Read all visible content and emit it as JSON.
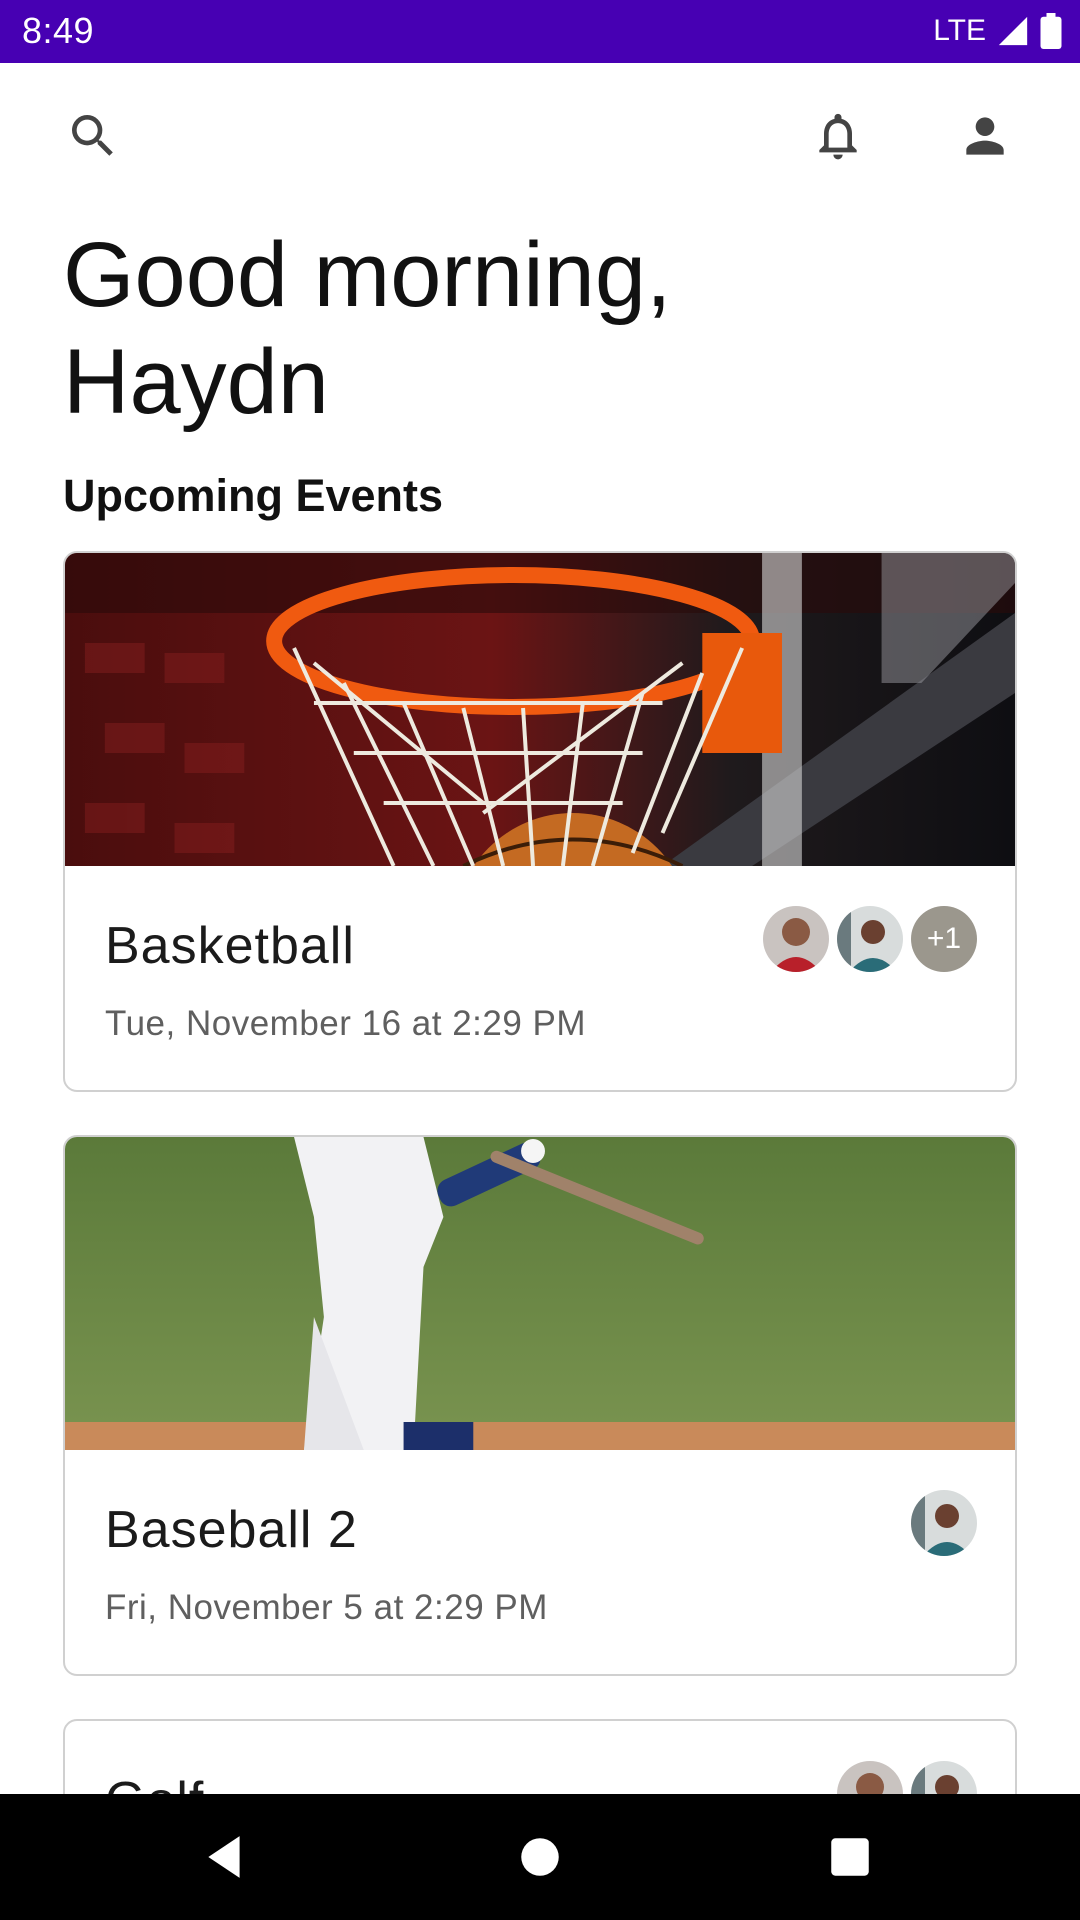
{
  "status_bar": {
    "time": "8:49",
    "network": "LTE"
  },
  "top_bar": {
    "icons": [
      "search-icon",
      "bell-icon",
      "account-icon"
    ]
  },
  "greeting": {
    "line1": "Good morning,",
    "line2": "Haydn"
  },
  "section": {
    "title": "Upcoming Events"
  },
  "events": [
    {
      "title": "Basketball",
      "date": "Tue, November 16 at 2:29 PM",
      "image": "basketball-hoop",
      "extra_attendees": "+1"
    },
    {
      "title": "Baseball 2",
      "date": "Fri, November 5 at 2:29 PM",
      "image": "baseball-batter"
    },
    {
      "title": "Golf"
    }
  ],
  "colors": {
    "status_bar": "#4700b3",
    "nav_bar": "#000000",
    "card_border": "#d0d0d0",
    "secondary_text": "#5f5f5f"
  }
}
